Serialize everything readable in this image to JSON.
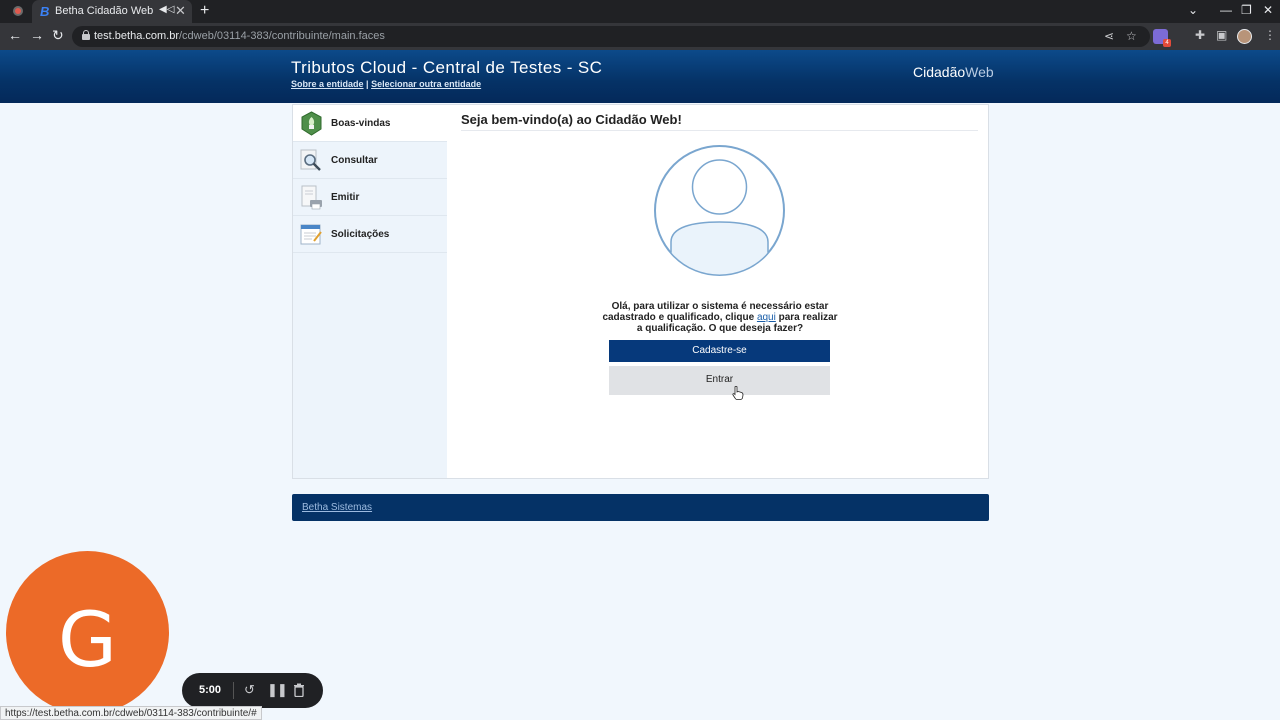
{
  "browser": {
    "tab_title": "Betha Cidadão Web",
    "tab_favicon": "B",
    "url_host": "test.betha.com.br",
    "url_path": "/cdweb/03114-383/contribuinte/main.faces",
    "extension_badge": "4",
    "status_url": "https://test.betha.com.br/cdweb/03114-383/contribuinte/#"
  },
  "header": {
    "title": "Tributos Cloud - Central de Testes - SC",
    "link_about": "Sobre a entidade",
    "separator": "|",
    "link_select": "Selecionar outra entidade",
    "brand_bold": "Cidadão",
    "brand_light": "Web"
  },
  "sidebar": {
    "items": [
      {
        "label": "Boas-vindas",
        "icon": "leaf-shield-icon"
      },
      {
        "label": "Consultar",
        "icon": "magnifier-icon"
      },
      {
        "label": "Emitir",
        "icon": "printer-document-icon"
      },
      {
        "label": "Solicitações",
        "icon": "form-edit-icon"
      }
    ]
  },
  "main": {
    "welcome": "Seja bem-vindo(a) ao Cidadão Web!",
    "msg_before": "Olá, para utilizar o sistema é necessário estar cadastrado e qualificado, clique ",
    "msg_link": "aqui",
    "msg_after": " para realizar a qualificação. O que deseja fazer?",
    "btn_register": "Cadastre-se",
    "btn_login": "Entrar"
  },
  "footer": {
    "link": "Betha Sistemas"
  },
  "overlay": {
    "avatar_letter": "G",
    "timer": "5:00"
  },
  "colors": {
    "header": "#053266",
    "primary_button": "#06397b",
    "secondary_button": "#e0e2e5",
    "page_background": "#f1f7fd",
    "sidebar": "#edf4fb",
    "avatar_orange": "#ec6a28"
  }
}
